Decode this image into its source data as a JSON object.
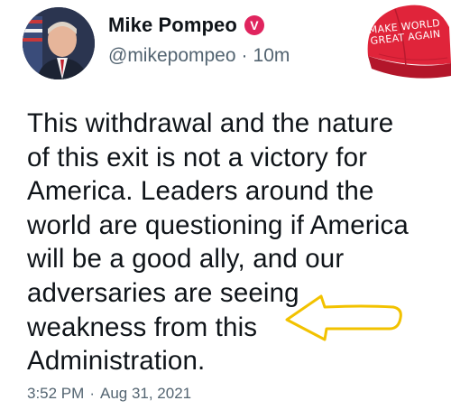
{
  "author": {
    "display_name": "Mike Pompeo",
    "verified_mark": "V",
    "handle": "@mikepompeo",
    "separator": "·",
    "relative_time": "10m"
  },
  "hat": {
    "line1": "MAKE WORLD",
    "line2": "GREAT AGAIN",
    "color": "#e0243a"
  },
  "tweet": {
    "lines": [
      "This withdrawal and the nature",
      "of this exit is not a victory for",
      "America. Leaders around the",
      "world are questioning if America",
      "will be a good ally, and our",
      "adversaries are seeing",
      "weakness from this",
      "Administration."
    ]
  },
  "footer": {
    "time": "3:52 PM",
    "separator": "·",
    "date": "Aug 31, 2021"
  },
  "colors": {
    "text": "#0f1419",
    "secondary": "#536471",
    "badge": "#e0245e",
    "arrow": "#f2c200"
  },
  "icons": {
    "avatar": "profile-photo",
    "badge": "verified-badge-icon",
    "hat": "red-cap-sticker",
    "arrow": "left-arrow-annotation"
  }
}
